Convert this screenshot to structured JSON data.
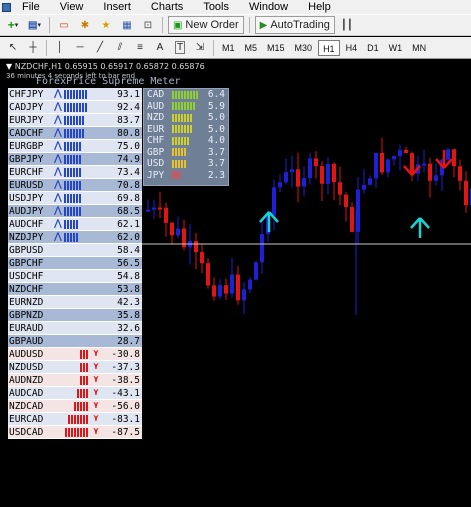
{
  "menu": {
    "items": [
      "File",
      "View",
      "Insert",
      "Charts",
      "Tools",
      "Window",
      "Help"
    ]
  },
  "toolbar": {
    "new_order_label": "New Order",
    "autotrading_label": "AutoTrading",
    "timeframes": [
      "M1",
      "M5",
      "M15",
      "M30",
      "H1",
      "H4",
      "D1",
      "W1",
      "MN"
    ],
    "active_timeframe": "H1",
    "draw_tools": [
      "A",
      "T"
    ]
  },
  "chart": {
    "symbol_line": "NZDCHF,H1  0.65915 0.65917 0.65872 0.65876",
    "indicator_note": "36 minutes 4 seconds left to bar end",
    "meter_title": "ForexPrice Supreme Meter",
    "colors": {
      "bull": "#1f1fd6",
      "bear": "#e01515",
      "arrow_up": "#19d2d2",
      "arrow_down": "#e01515",
      "hline": "#c8c8c8"
    }
  },
  "pairs": [
    {
      "pair": "CHFJPY",
      "value": "93.1",
      "dir": "up",
      "bars": 8,
      "bar_color": "#2646c8",
      "bg": "#dfe6f2"
    },
    {
      "pair": "CADJPY",
      "value": "92.4",
      "dir": "up",
      "bars": 8,
      "bar_color": "#2646c8",
      "bg": "#dfe6f2"
    },
    {
      "pair": "EURJPY",
      "value": "83.7",
      "dir": "up",
      "bars": 7,
      "bar_color": "#2646c8",
      "bg": "#dfe6f2"
    },
    {
      "pair": "CADCHF",
      "value": "80.8",
      "dir": "up",
      "bars": 7,
      "bar_color": "#2646c8",
      "bg": "#a8b9d6"
    },
    {
      "pair": "EURGBP",
      "value": "75.0",
      "dir": "up",
      "bars": 6,
      "bar_color": "#2646c8",
      "bg": "#dfe6f2"
    },
    {
      "pair": "GBPJPY",
      "value": "74.9",
      "dir": "up",
      "bars": 6,
      "bar_color": "#2646c8",
      "bg": "#a8b9d6"
    },
    {
      "pair": "EURCHF",
      "value": "73.4",
      "dir": "up",
      "bars": 6,
      "bar_color": "#2646c8",
      "bg": "#dfe6f2"
    },
    {
      "pair": "EURUSD",
      "value": "70.8",
      "dir": "up",
      "bars": 6,
      "bar_color": "#2646c8",
      "bg": "#a8b9d6"
    },
    {
      "pair": "USDJPY",
      "value": "69.8",
      "dir": "up",
      "bars": 6,
      "bar_color": "#2646c8",
      "bg": "#dfe6f2"
    },
    {
      "pair": "AUDJPY",
      "value": "68.5",
      "dir": "up",
      "bars": 6,
      "bar_color": "#2646c8",
      "bg": "#a8b9d6"
    },
    {
      "pair": "AUDCHF",
      "value": "62.1",
      "dir": "up",
      "bars": 5,
      "bar_color": "#2646c8",
      "bg": "#dfe6f2"
    },
    {
      "pair": "NZDJPY",
      "value": "62.0",
      "dir": "up",
      "bars": 5,
      "bar_color": "#2646c8",
      "bg": "#a8b9d6"
    },
    {
      "pair": "GBPUSD",
      "value": "58.4",
      "dir": "",
      "bars": 0,
      "bar_color": "#2646c8",
      "bg": "#dfe6f2"
    },
    {
      "pair": "GBPCHF",
      "value": "56.5",
      "dir": "",
      "bars": 0,
      "bar_color": "#2646c8",
      "bg": "#a8b9d6"
    },
    {
      "pair": "USDCHF",
      "value": "54.8",
      "dir": "",
      "bars": 0,
      "bar_color": "#2646c8",
      "bg": "#dfe6f2"
    },
    {
      "pair": "NZDCHF",
      "value": "53.8",
      "dir": "",
      "bars": 0,
      "bar_color": "#2646c8",
      "bg": "#a8b9d6"
    },
    {
      "pair": "EURNZD",
      "value": "42.3",
      "dir": "",
      "bars": 0,
      "bar_color": "#2646c8",
      "bg": "#dfe6f2"
    },
    {
      "pair": "GBPNZD",
      "value": "35.8",
      "dir": "",
      "bars": 0,
      "bar_color": "#2646c8",
      "bg": "#a8b9d6"
    },
    {
      "pair": "EURAUD",
      "value": "32.6",
      "dir": "",
      "bars": 0,
      "bar_color": "#2646c8",
      "bg": "#dfe6f2"
    },
    {
      "pair": "GBPAUD",
      "value": "28.7",
      "dir": "",
      "bars": 0,
      "bar_color": "#2646c8",
      "bg": "#a8b9d6"
    },
    {
      "pair": "AUDUSD",
      "value": "-30.8",
      "dir": "down",
      "bars": 3,
      "bar_color": "#e01515",
      "bg": "#f5e4e4"
    },
    {
      "pair": "NZDUSD",
      "value": "-37.3",
      "dir": "down",
      "bars": 3,
      "bar_color": "#e01515",
      "bg": "#dfe6f2"
    },
    {
      "pair": "AUDNZD",
      "value": "-38.5",
      "dir": "down",
      "bars": 3,
      "bar_color": "#e01515",
      "bg": "#f5e4e4"
    },
    {
      "pair": "AUDCAD",
      "value": "-43.1",
      "dir": "down",
      "bars": 4,
      "bar_color": "#e01515",
      "bg": "#dfe6f2"
    },
    {
      "pair": "NZDCAD",
      "value": "-56.0",
      "dir": "down",
      "bars": 5,
      "bar_color": "#e01515",
      "bg": "#f5e4e4"
    },
    {
      "pair": "EURCAD",
      "value": "-83.1",
      "dir": "down",
      "bars": 7,
      "bar_color": "#e01515",
      "bg": "#dfe6f2"
    },
    {
      "pair": "USDCAD",
      "value": "-87.5",
      "dir": "down",
      "bars": 8,
      "bar_color": "#e01515",
      "bg": "#f5e4e4"
    }
  ],
  "currencies": [
    {
      "name": "CAD",
      "value": "6.4",
      "bars": 9,
      "color": "#8fd22c"
    },
    {
      "name": "AUD",
      "value": "5.9",
      "bars": 8,
      "color": "#8fd22c"
    },
    {
      "name": "NZD",
      "value": "5.0",
      "bars": 7,
      "color": "#cfd02a"
    },
    {
      "name": "EUR",
      "value": "5.0",
      "bars": 7,
      "color": "#cfd02a"
    },
    {
      "name": "CHF",
      "value": "4.0",
      "bars": 6,
      "color": "#cfd02a"
    },
    {
      "name": "GBP",
      "value": "3.7",
      "bars": 5,
      "color": "#e8c227"
    },
    {
      "name": "USD",
      "value": "3.7",
      "bars": 5,
      "color": "#e8c227"
    },
    {
      "name": "JPY",
      "value": "2.3",
      "bars": 3,
      "color": "#e05050"
    }
  ]
}
